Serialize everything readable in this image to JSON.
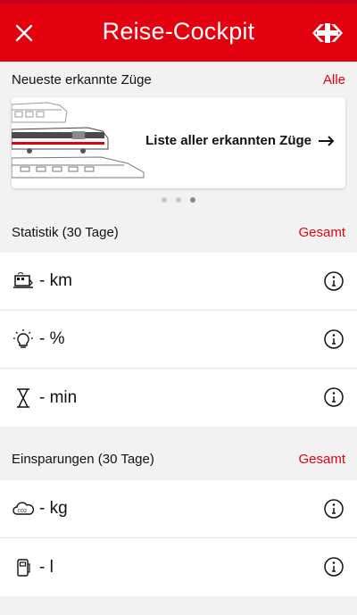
{
  "header": {
    "title": "Reise-Cockpit",
    "close_icon": "close-icon",
    "logo_icon": "sbb-logo-icon",
    "color": "#e3000f"
  },
  "trains_section": {
    "title": "Neueste erkannte Züge",
    "link": "Alle",
    "carousel_cta": "Liste aller erkannten Züge",
    "pages": 3,
    "active_page": 3
  },
  "stats_section": {
    "title": "Statistik (30 Tage)",
    "link": "Gesamt",
    "rows": [
      {
        "icon": "train-icon",
        "value": "- km"
      },
      {
        "icon": "lightbulb-icon",
        "value": "- %"
      },
      {
        "icon": "hourglass-icon",
        "value": "- min"
      }
    ]
  },
  "savings_section": {
    "title": "Einsparungen (30 Tage)",
    "link": "Gesamt",
    "rows": [
      {
        "icon": "co2-cloud-icon",
        "value": "- kg"
      },
      {
        "icon": "fuel-icon",
        "value": "- l"
      }
    ]
  }
}
